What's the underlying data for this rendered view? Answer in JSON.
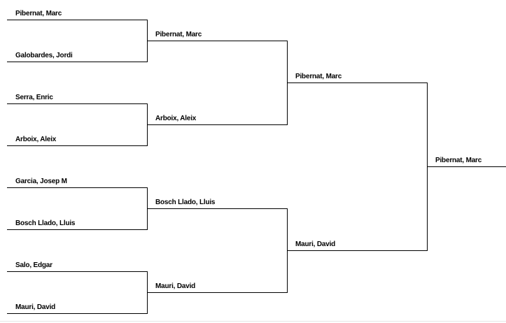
{
  "rounds": [
    {
      "name": "round-1",
      "entries": [
        "Pibernat, Marc",
        "Galobardes, Jordi",
        "Serra, Enric",
        "Arboix, Aleix",
        "Garcia, Josep M",
        "Bosch Llado, Lluis",
        "Salo, Edgar",
        "Mauri, David"
      ]
    },
    {
      "name": "round-2",
      "entries": [
        "Pibernat, Marc",
        "Arboix, Aleix",
        "Bosch Llado, Lluis",
        "Mauri, David"
      ]
    },
    {
      "name": "round-3",
      "entries": [
        "Pibernat, Marc",
        "Mauri, David"
      ]
    },
    {
      "name": "final",
      "entries": [
        "Pibernat, Marc"
      ]
    }
  ],
  "style": {
    "line_color": "#000000",
    "text_color": "#000000"
  }
}
